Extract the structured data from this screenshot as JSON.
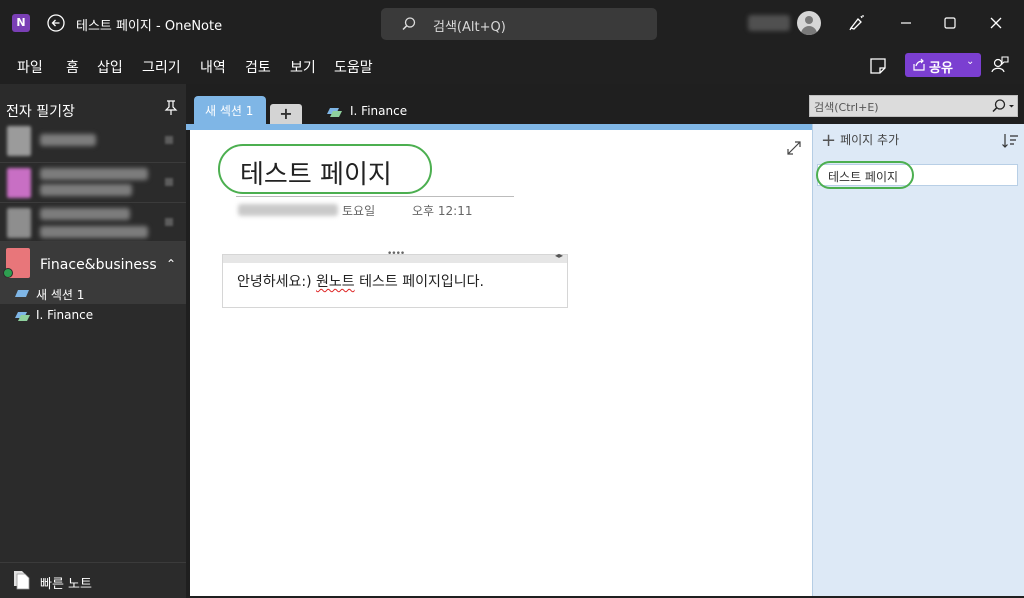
{
  "titlebar": {
    "app_icon_letter": "N",
    "window_title": "테스트 페이지  -  OneNote",
    "search_placeholder": "검색(Alt+Q)"
  },
  "menu": {
    "items": [
      "파일",
      "홈",
      "삽입",
      "그리기",
      "내역",
      "검토",
      "보기",
      "도움말"
    ],
    "share_label": "공유"
  },
  "sidebar": {
    "header": "전자 필기장",
    "active_notebook": "Finace&business",
    "sections": [
      "새 섹션 1",
      "I. Finance"
    ],
    "quick_notes": "빠른 노트"
  },
  "tabs": {
    "active": "새 섹션 1",
    "add": "+",
    "other": "I. Finance"
  },
  "page": {
    "title": "테스트 페이지",
    "day": "토요일",
    "time": "오후 12:11",
    "body_before": "안녕하세요:) ",
    "body_misspelled": "원노트",
    "body_after": " 테스트 페이지입니다."
  },
  "pages_pane": {
    "search_placeholder": "검색(Ctrl+E)",
    "add_page": "페이지 추가",
    "pages": [
      "테스트 페이지"
    ]
  },
  "colors": {
    "accent_purple": "#7b3fd1",
    "section_blue": "#7fb6e6",
    "highlight_green": "#4caf50",
    "notebook_pink": "#e8767a"
  }
}
